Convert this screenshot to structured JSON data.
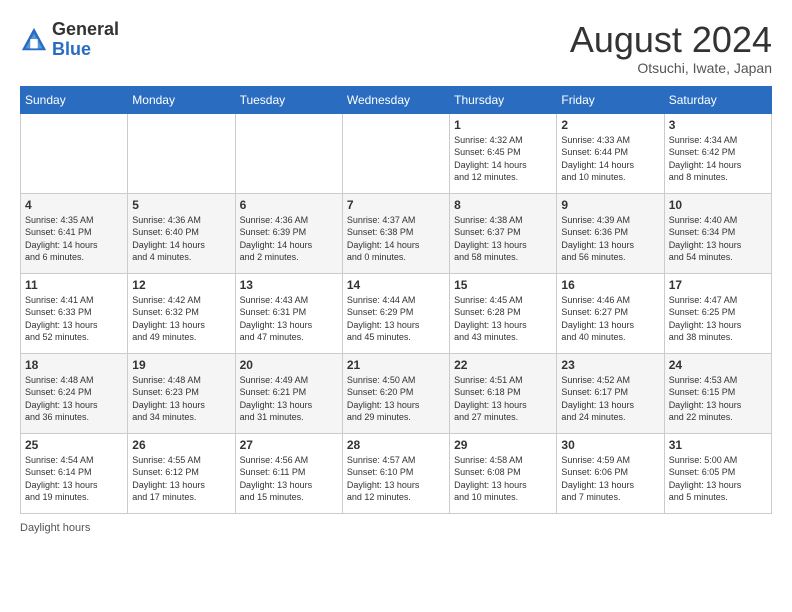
{
  "header": {
    "logo_general": "General",
    "logo_blue": "Blue",
    "month_year": "August 2024",
    "location": "Otsuchi, Iwate, Japan"
  },
  "days_of_week": [
    "Sunday",
    "Monday",
    "Tuesday",
    "Wednesday",
    "Thursday",
    "Friday",
    "Saturday"
  ],
  "weeks": [
    [
      {
        "day": "",
        "info": ""
      },
      {
        "day": "",
        "info": ""
      },
      {
        "day": "",
        "info": ""
      },
      {
        "day": "",
        "info": ""
      },
      {
        "day": "1",
        "info": "Sunrise: 4:32 AM\nSunset: 6:45 PM\nDaylight: 14 hours\nand 12 minutes."
      },
      {
        "day": "2",
        "info": "Sunrise: 4:33 AM\nSunset: 6:44 PM\nDaylight: 14 hours\nand 10 minutes."
      },
      {
        "day": "3",
        "info": "Sunrise: 4:34 AM\nSunset: 6:42 PM\nDaylight: 14 hours\nand 8 minutes."
      }
    ],
    [
      {
        "day": "4",
        "info": "Sunrise: 4:35 AM\nSunset: 6:41 PM\nDaylight: 14 hours\nand 6 minutes."
      },
      {
        "day": "5",
        "info": "Sunrise: 4:36 AM\nSunset: 6:40 PM\nDaylight: 14 hours\nand 4 minutes."
      },
      {
        "day": "6",
        "info": "Sunrise: 4:36 AM\nSunset: 6:39 PM\nDaylight: 14 hours\nand 2 minutes."
      },
      {
        "day": "7",
        "info": "Sunrise: 4:37 AM\nSunset: 6:38 PM\nDaylight: 14 hours\nand 0 minutes."
      },
      {
        "day": "8",
        "info": "Sunrise: 4:38 AM\nSunset: 6:37 PM\nDaylight: 13 hours\nand 58 minutes."
      },
      {
        "day": "9",
        "info": "Sunrise: 4:39 AM\nSunset: 6:36 PM\nDaylight: 13 hours\nand 56 minutes."
      },
      {
        "day": "10",
        "info": "Sunrise: 4:40 AM\nSunset: 6:34 PM\nDaylight: 13 hours\nand 54 minutes."
      }
    ],
    [
      {
        "day": "11",
        "info": "Sunrise: 4:41 AM\nSunset: 6:33 PM\nDaylight: 13 hours\nand 52 minutes."
      },
      {
        "day": "12",
        "info": "Sunrise: 4:42 AM\nSunset: 6:32 PM\nDaylight: 13 hours\nand 49 minutes."
      },
      {
        "day": "13",
        "info": "Sunrise: 4:43 AM\nSunset: 6:31 PM\nDaylight: 13 hours\nand 47 minutes."
      },
      {
        "day": "14",
        "info": "Sunrise: 4:44 AM\nSunset: 6:29 PM\nDaylight: 13 hours\nand 45 minutes."
      },
      {
        "day": "15",
        "info": "Sunrise: 4:45 AM\nSunset: 6:28 PM\nDaylight: 13 hours\nand 43 minutes."
      },
      {
        "day": "16",
        "info": "Sunrise: 4:46 AM\nSunset: 6:27 PM\nDaylight: 13 hours\nand 40 minutes."
      },
      {
        "day": "17",
        "info": "Sunrise: 4:47 AM\nSunset: 6:25 PM\nDaylight: 13 hours\nand 38 minutes."
      }
    ],
    [
      {
        "day": "18",
        "info": "Sunrise: 4:48 AM\nSunset: 6:24 PM\nDaylight: 13 hours\nand 36 minutes."
      },
      {
        "day": "19",
        "info": "Sunrise: 4:48 AM\nSunset: 6:23 PM\nDaylight: 13 hours\nand 34 minutes."
      },
      {
        "day": "20",
        "info": "Sunrise: 4:49 AM\nSunset: 6:21 PM\nDaylight: 13 hours\nand 31 minutes."
      },
      {
        "day": "21",
        "info": "Sunrise: 4:50 AM\nSunset: 6:20 PM\nDaylight: 13 hours\nand 29 minutes."
      },
      {
        "day": "22",
        "info": "Sunrise: 4:51 AM\nSunset: 6:18 PM\nDaylight: 13 hours\nand 27 minutes."
      },
      {
        "day": "23",
        "info": "Sunrise: 4:52 AM\nSunset: 6:17 PM\nDaylight: 13 hours\nand 24 minutes."
      },
      {
        "day": "24",
        "info": "Sunrise: 4:53 AM\nSunset: 6:15 PM\nDaylight: 13 hours\nand 22 minutes."
      }
    ],
    [
      {
        "day": "25",
        "info": "Sunrise: 4:54 AM\nSunset: 6:14 PM\nDaylight: 13 hours\nand 19 minutes."
      },
      {
        "day": "26",
        "info": "Sunrise: 4:55 AM\nSunset: 6:12 PM\nDaylight: 13 hours\nand 17 minutes."
      },
      {
        "day": "27",
        "info": "Sunrise: 4:56 AM\nSunset: 6:11 PM\nDaylight: 13 hours\nand 15 minutes."
      },
      {
        "day": "28",
        "info": "Sunrise: 4:57 AM\nSunset: 6:10 PM\nDaylight: 13 hours\nand 12 minutes."
      },
      {
        "day": "29",
        "info": "Sunrise: 4:58 AM\nSunset: 6:08 PM\nDaylight: 13 hours\nand 10 minutes."
      },
      {
        "day": "30",
        "info": "Sunrise: 4:59 AM\nSunset: 6:06 PM\nDaylight: 13 hours\nand 7 minutes."
      },
      {
        "day": "31",
        "info": "Sunrise: 5:00 AM\nSunset: 6:05 PM\nDaylight: 13 hours\nand 5 minutes."
      }
    ]
  ],
  "footer": {
    "daylight_label": "Daylight hours"
  }
}
